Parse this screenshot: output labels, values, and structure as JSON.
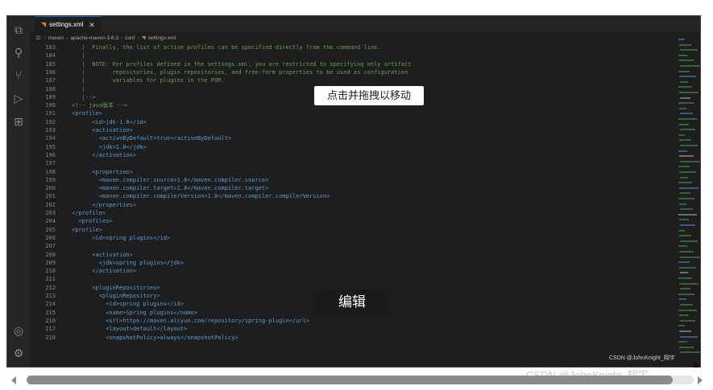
{
  "tab": {
    "label": "settings.xml",
    "close": "✕"
  },
  "breadcrumb": [
    "D:",
    "maven",
    "apache-maven-3.6.3",
    "conf",
    "settings.xml"
  ],
  "lines": [
    {
      "n": "183",
      "t": "   |  Finally, the list of active profiles can be specified directly from the command line.",
      "k": "comment"
    },
    {
      "n": "184",
      "t": "   |",
      "k": "comment"
    },
    {
      "n": "185",
      "t": "   |  NOTE: For profiles defined in the settings.xml, you are restricted to specifying only artifact",
      "k": "comment"
    },
    {
      "n": "186",
      "t": "   |        repositories, plugin repositories, and free-form properties to be used as configuration",
      "k": "comment"
    },
    {
      "n": "187",
      "t": "   |        variables for plugins in the POM.",
      "k": "comment"
    },
    {
      "n": "188",
      "t": "   |",
      "k": "comment"
    },
    {
      "n": "189",
      "t": "   |-->",
      "k": "comment"
    },
    {
      "n": "190",
      "t": "<!-- java版本 -->",
      "k": "comment"
    },
    {
      "n": "191",
      "t": "<profile>",
      "k": "tag"
    },
    {
      "n": "192",
      "t": "      <id>jdk-1.8</id>",
      "k": "tag"
    },
    {
      "n": "193",
      "t": "      <activation>",
      "k": "tag"
    },
    {
      "n": "194",
      "t": "        <activeByDefault>true</activeByDefault>",
      "k": "tag"
    },
    {
      "n": "195",
      "t": "        <jdk>1.8</jdk>",
      "k": "tag"
    },
    {
      "n": "196",
      "t": "      </activation>",
      "k": "tag"
    },
    {
      "n": "197",
      "t": "",
      "k": "text"
    },
    {
      "n": "198",
      "t": "      <properties>",
      "k": "tag"
    },
    {
      "n": "199",
      "t": "        <maven.compiler.source>1.8</maven.compiler.source>",
      "k": "tag"
    },
    {
      "n": "200",
      "t": "        <maven.compiler.target>1.8</maven.compiler.target>",
      "k": "tag"
    },
    {
      "n": "201",
      "t": "        <maven.compiler.compilerVersion>1.8</maven.compiler.compilerVersion>",
      "k": "tag"
    },
    {
      "n": "202",
      "t": "      </properties>",
      "k": "tag"
    },
    {
      "n": "203",
      "t": "</profile>",
      "k": "tag"
    },
    {
      "n": "204",
      "t": "  <profiles>",
      "k": "tag"
    },
    {
      "n": "205",
      "t": "<profile>",
      "k": "tag"
    },
    {
      "n": "206",
      "t": "      <id>spring plugins</id>",
      "k": "tag"
    },
    {
      "n": "207",
      "t": "",
      "k": "text"
    },
    {
      "n": "208",
      "t": "      <activation>",
      "k": "tag"
    },
    {
      "n": "209",
      "t": "        <jdk>spring plugins</jdk>",
      "k": "tag"
    },
    {
      "n": "210",
      "t": "      </activation>",
      "k": "tag"
    },
    {
      "n": "211",
      "t": "",
      "k": "text"
    },
    {
      "n": "212",
      "t": "      <pluginRepositories>",
      "k": "tag"
    },
    {
      "n": "213",
      "t": "        <pluginRepository>",
      "k": "tag"
    },
    {
      "n": "214",
      "t": "          <id>spring plugins</id>",
      "k": "tag"
    },
    {
      "n": "215",
      "t": "          <name>Spring plugins</name>",
      "k": "tag"
    },
    {
      "n": "216",
      "t": "          <url>https://maven.aliyun.com/repository/spring-plugin</url>",
      "k": "tag"
    },
    {
      "n": "217",
      "t": "          <layout>default</layout>",
      "k": "tag"
    },
    {
      "n": "218",
      "t": "          <snapshotPolicy>always</snapshotPolicy>",
      "k": "tag"
    }
  ],
  "overlay": {
    "drag_tip": "点击并拖拽以移动",
    "edit": "编辑"
  },
  "watermark": {
    "inner": "CSDN @JohnKnight_翔宇",
    "outer": "CSDN @JohnKnight_翔宇"
  },
  "icons": [
    "files-icon",
    "search-icon",
    "source-control-icon",
    "run-debug-icon",
    "extensions-icon",
    "account-icon",
    "settings-gear-icon"
  ]
}
